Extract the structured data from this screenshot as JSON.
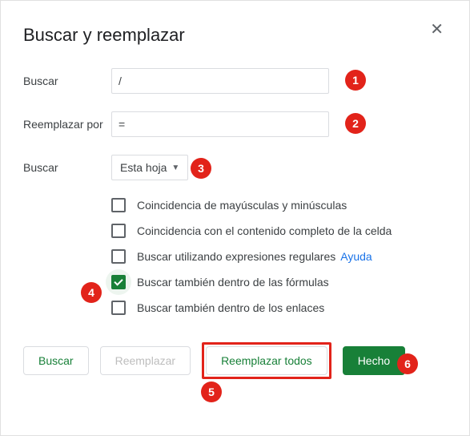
{
  "title": "Buscar y reemplazar",
  "labels": {
    "find": "Buscar",
    "replace_with": "Reemplazar por",
    "search_scope": "Buscar"
  },
  "inputs": {
    "find_value": "/",
    "replace_value": "="
  },
  "dropdown": {
    "selected": "Esta hoja"
  },
  "options": {
    "match_case": "Coincidencia de mayúsculas y minúsculas",
    "match_entire_cell": "Coincidencia con el contenido completo de la celda",
    "use_regex": "Buscar utilizando expresiones regulares",
    "regex_help": "Ayuda",
    "within_formulas": "Buscar también dentro de las fórmulas",
    "within_links": "Buscar también dentro de los enlaces"
  },
  "buttons": {
    "find": "Buscar",
    "replace": "Reemplazar",
    "replace_all": "Reemplazar todos",
    "done": "Hecho"
  },
  "annotations": {
    "a1": "1",
    "a2": "2",
    "a3": "3",
    "a4": "4",
    "a5": "5",
    "a6": "6"
  }
}
